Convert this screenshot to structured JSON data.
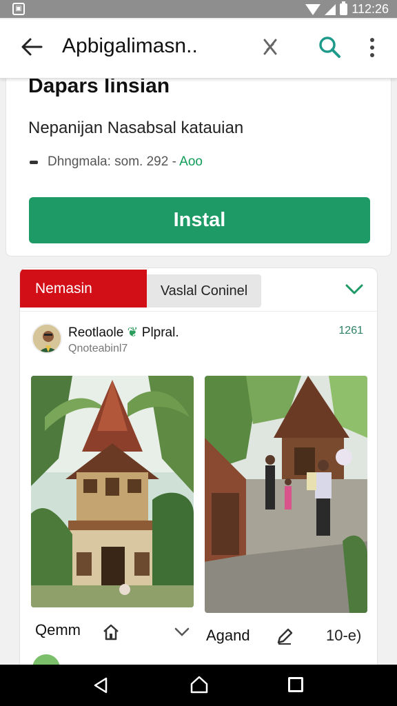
{
  "status_bar": {
    "time": "112:26",
    "left_icon": "notification-icon",
    "icons": [
      "wifi-icon",
      "signal-icon",
      "battery-icon"
    ]
  },
  "toolbar": {
    "title": "Apbigalimasn..",
    "icons": [
      "back-arrow-icon",
      "close-icon",
      "search-icon",
      "more-vert-icon"
    ]
  },
  "app_card": {
    "name": "Dapars linsian",
    "developer": "Nepanijan Nasabsal katauian",
    "meta_text": "Dhngmala: som. 292 -",
    "meta_accent": "Aoo",
    "install_label": "Instal"
  },
  "post_card": {
    "tab_active": "Nemasin",
    "tab_secondary": "Vaslal Coninel",
    "author_name": "Reotlaole",
    "author_suffix": "Plpral.",
    "author_handle": "Qnoteabinl7",
    "time": "1261",
    "photo_1": "traditional-house-photo",
    "photo_2": "courtyard-people-photo",
    "action_1_label": "Qemm",
    "action_2_label": "Agand",
    "action_count": "10-e)"
  },
  "colors": {
    "install_green": "#1d9a65",
    "tab_red": "#d20f17",
    "accent_green": "#0f9d58",
    "status_bar": "#8e8e8e"
  },
  "nav_bar": {
    "icons": [
      "nav-back-icon",
      "nav-home-icon",
      "nav-recents-icon"
    ]
  }
}
